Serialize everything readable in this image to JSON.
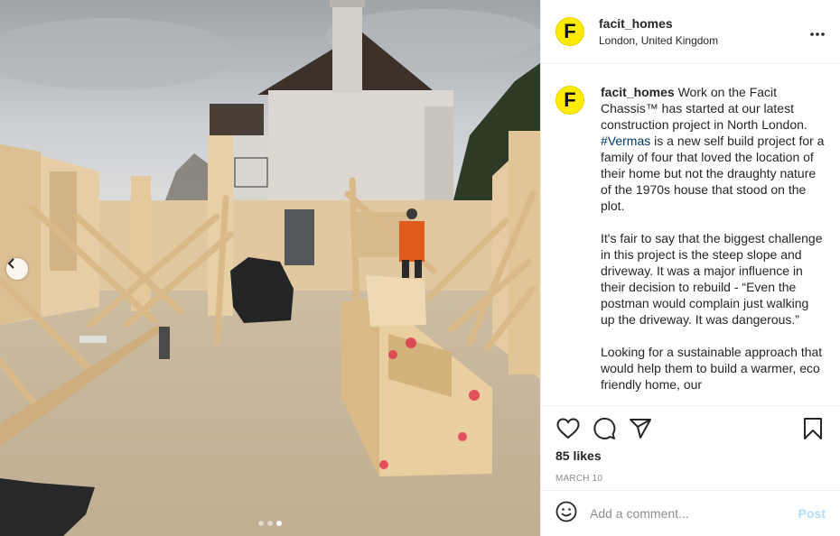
{
  "post": {
    "username": "facit_homes",
    "location": "London, United Kingdom",
    "avatar_letter": "F",
    "avatar_color": "#ffeb00",
    "more_icon": "more-horizontal-icon",
    "caption": {
      "username": "facit_homes",
      "p1_before_tag": " Work on the Facit Chassis™ has started at our latest construction project in North London. ",
      "hashtag": "#Vermas",
      "p1_after_tag": " is a new self build project for a family of four that loved the location of their home but not the draughty nature of the 1970s house that stood on the plot.",
      "p2": "It's fair to say that the biggest challenge in this project is the steep slope and driveway. It was a major influence in their decision to rebuild - “Even the postman would complain just walking up the driveway. It was dangerous.”",
      "p3": "Looking for a sustainable approach that would help them to build a warmer, eco friendly home, our"
    },
    "likes": "85 likes",
    "date": "MARCH 10",
    "comment_placeholder": "Add a comment...",
    "post_label": "Post",
    "link_color": "#00376b",
    "post_button_color": "#b2dffc"
  },
  "carousel": {
    "slide_count": 3,
    "active_index": 3
  }
}
